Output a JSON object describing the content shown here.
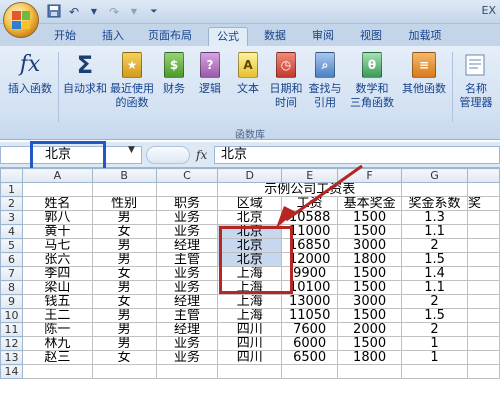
{
  "app": {
    "title": "EX",
    "qat": [
      "save-icon",
      "undo-icon",
      "redo-icon",
      "customize-icon"
    ]
  },
  "tabs": [
    "开始",
    "插入",
    "页面布局",
    "公式",
    "数据",
    "审阅",
    "视图",
    "加载项"
  ],
  "active_tab": "公式",
  "ribbon": {
    "buttons": [
      {
        "label1": "插入函数",
        "label2": "",
        "icon": "fx-icon"
      },
      {
        "label1": "自动求和",
        "label2": "",
        "icon": "sigma-icon"
      },
      {
        "label1": "最近使用",
        "label2": "的函数",
        "icon": "book-icon"
      },
      {
        "label1": "财务",
        "label2": "",
        "icon": "book-icon"
      },
      {
        "label1": "逻辑",
        "label2": "",
        "icon": "book-icon"
      },
      {
        "label1": "文本",
        "label2": "",
        "icon": "book-icon"
      },
      {
        "label1": "日期和",
        "label2": "时间",
        "icon": "book-icon"
      },
      {
        "label1": "查找与",
        "label2": "引用",
        "icon": "book-icon"
      },
      {
        "label1": "数学和",
        "label2": "三角函数",
        "icon": "book-icon"
      },
      {
        "label1": "其他函数",
        "label2": "",
        "icon": "book-icon"
      },
      {
        "label1": "名称",
        "label2": "管理器",
        "icon": "name-manager-icon"
      }
    ],
    "group_label": "函数库"
  },
  "formula_bar": {
    "name_box": "北京",
    "fx": "fx",
    "content": "北京"
  },
  "sheet": {
    "columns": [
      "A",
      "B",
      "C",
      "D",
      "E",
      "F",
      "G"
    ],
    "title": "示例公司工资表",
    "headers": [
      "姓名",
      "性别",
      "职务",
      "区域",
      "工资",
      "基本奖金",
      "奖金系数",
      "奖"
    ],
    "rows": [
      [
        "郭八",
        "男",
        "业务",
        "北京",
        "10588",
        "1500",
        "1.3"
      ],
      [
        "黄十",
        "女",
        "业务",
        "北京",
        "11000",
        "1500",
        "1.1"
      ],
      [
        "马七",
        "男",
        "经理",
        "北京",
        "16850",
        "3000",
        "2"
      ],
      [
        "张六",
        "男",
        "主管",
        "北京",
        "12000",
        "1800",
        "1.5"
      ],
      [
        "李四",
        "女",
        "业务",
        "上海",
        "9900",
        "1500",
        "1.4"
      ],
      [
        "梁山",
        "男",
        "业务",
        "上海",
        "10100",
        "1500",
        "1.1"
      ],
      [
        "钱五",
        "女",
        "经理",
        "上海",
        "13000",
        "3000",
        "2"
      ],
      [
        "王二",
        "男",
        "主管",
        "上海",
        "11050",
        "1500",
        "1.5"
      ],
      [
        "陈一",
        "男",
        "经理",
        "四川",
        "7600",
        "2000",
        "2"
      ],
      [
        "林九",
        "男",
        "业务",
        "四川",
        "6000",
        "1500",
        "1"
      ],
      [
        "赵三",
        "女",
        "业务",
        "四川",
        "6500",
        "1800",
        "1"
      ]
    ],
    "row_numbers": [
      "1",
      "2",
      "3",
      "4",
      "5",
      "6",
      "7",
      "8",
      "9",
      "10",
      "11",
      "12",
      "13",
      "14"
    ]
  },
  "colors": {
    "blue_highlight": "#2457c5",
    "red_highlight": "#b62624",
    "selection": "#c7d7ee"
  }
}
